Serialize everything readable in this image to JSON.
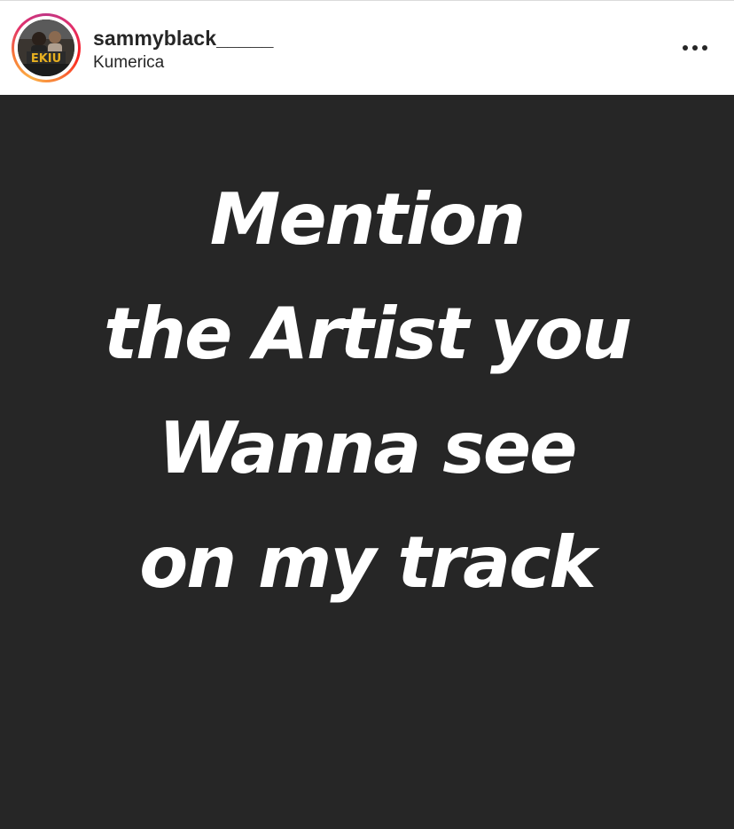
{
  "post": {
    "header": {
      "username": "sammyblack_____",
      "location": "Kumerica",
      "avatar_icon": "profile-avatar",
      "more_icon": "more-options-icon"
    },
    "image": {
      "background_color": "#262626",
      "text_color": "#ffffff",
      "lines": [
        "Mention",
        "the Artist you",
        "Wanna see",
        "on my track"
      ]
    }
  }
}
